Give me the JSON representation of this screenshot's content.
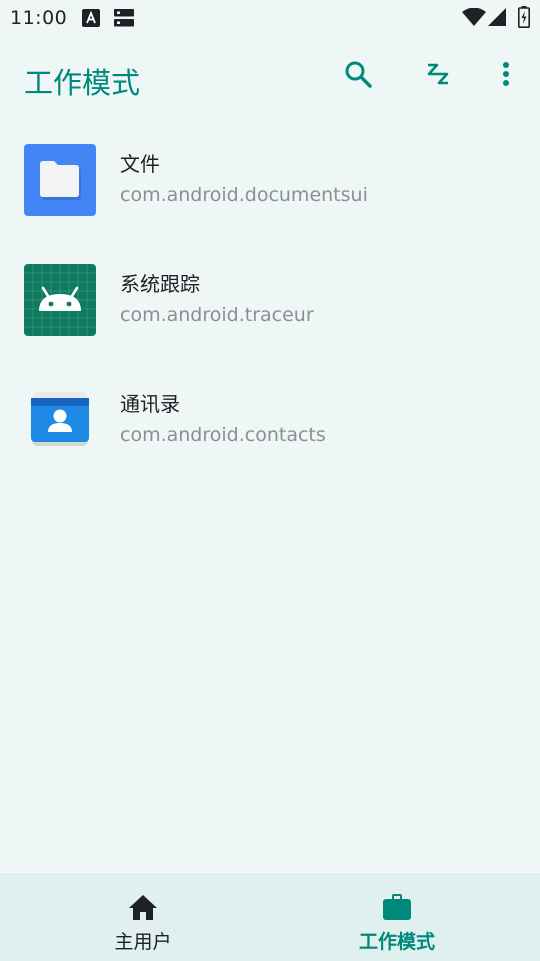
{
  "status_bar": {
    "time": "11:00",
    "icons": [
      "font-a-icon",
      "server-icon",
      "wifi-icon",
      "signal-icon",
      "battery-charging-icon"
    ]
  },
  "toolbar": {
    "title": "工作模式",
    "actions": [
      "search-icon",
      "sleep-zz-icon",
      "more-vert-icon"
    ]
  },
  "apps": [
    {
      "name": "文件",
      "package": "com.android.documentsui",
      "icon": "files-folder-icon",
      "icon_color": "#4285f4"
    },
    {
      "name": "系统跟踪",
      "package": "com.android.traceur",
      "icon": "android-robot-icon",
      "icon_color": "#0f7a5f"
    },
    {
      "name": "通讯录",
      "package": "com.android.contacts",
      "icon": "contacts-icon",
      "icon_color": "#1e88e5"
    }
  ],
  "bottom_nav": {
    "items": [
      {
        "label": "主用户",
        "icon": "home-icon",
        "selected": false
      },
      {
        "label": "工作模式",
        "icon": "work-briefcase-icon",
        "selected": true
      }
    ]
  },
  "colors": {
    "accent": "#00897b",
    "background": "#eef7f6",
    "nav_background": "#dff0ef",
    "secondary_text": "#8a8f93"
  }
}
